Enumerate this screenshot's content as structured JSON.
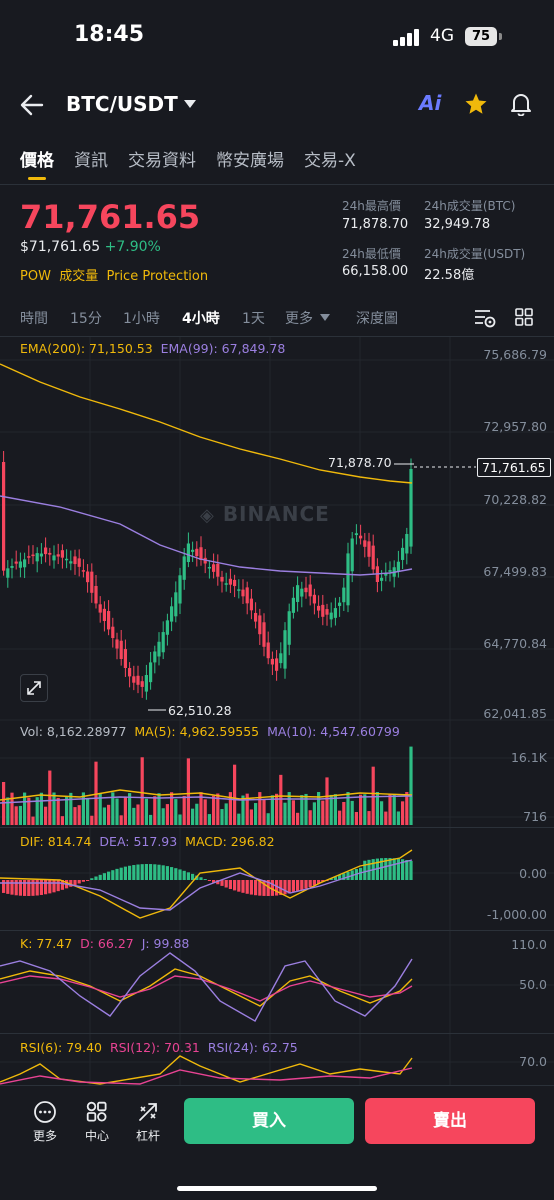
{
  "status_bar": {
    "time": "18:45",
    "network": "4G",
    "battery": "75"
  },
  "header": {
    "pair": "BTC/USDT",
    "icons": [
      "back-arrow-icon",
      "dropdown-caret-icon",
      "ai-icon",
      "star-icon",
      "bell-icon"
    ],
    "ai_label": "Ai"
  },
  "tabs": [
    "價格",
    "資訊",
    "交易資料",
    "幣安廣場",
    "交易-X"
  ],
  "price": {
    "last": "71,761.65",
    "usd": "$71,761.65",
    "change": "+7.90%",
    "tags": [
      "POW",
      "成交量",
      "Price Protection"
    ]
  },
  "stats": {
    "high_label": "24h最高價",
    "high_value": "71,878.70",
    "vol_btc_label": "24h成交量(BTC)",
    "vol_btc_value": "32,949.78",
    "low_label": "24h最低價",
    "low_value": "66,158.00",
    "vol_usdt_label": "24h成交量(USDT)",
    "vol_usdt_value": "22.58億"
  },
  "intervals": {
    "time": "時間",
    "m15": "15分",
    "h1": "1小時",
    "h4": "4小時",
    "d1": "1天",
    "more": "更多",
    "depth": "深度圖"
  },
  "main_chart": {
    "ema200_label": "EMA(200): 71,150.53",
    "ema99_label": "EMA(99): 67,849.78",
    "y_ticks": [
      "75,686.79",
      "72,957.80",
      "70,228.82",
      "67,499.83",
      "64,770.84",
      "62,041.85"
    ],
    "high_marker": "71,878.70",
    "low_marker": "62,510.28",
    "last_price_tag": "71,761.65",
    "watermark": "BINANCE"
  },
  "volume": {
    "vol_label": "Vol: 8,162.28977",
    "ma5_label": "MA(5): 4,962.59555",
    "ma10_label": "MA(10): 4,547.60799",
    "y_ticks": [
      "16.1K",
      "716"
    ]
  },
  "macd": {
    "dif_label": "DIF: 814.74",
    "dea_label": "DEA: 517.93",
    "macd_label": "MACD: 296.82",
    "y_ticks": [
      "0.00",
      "-1,000.00"
    ]
  },
  "kdj": {
    "k_label": "K: 77.47",
    "d_label": "D: 66.27",
    "j_label": "J: 99.88",
    "y_ticks": [
      "110.0",
      "50.0"
    ]
  },
  "rsi": {
    "rsi6_label": "RSI(6): 79.40",
    "rsi12_label": "RSI(12): 70.31",
    "rsi24_label": "RSI(24): 62.75",
    "y_ticks": [
      "70.0"
    ]
  },
  "bottom": {
    "more": "更多",
    "center": "中心",
    "leverage": "杠杆",
    "buy": "買入",
    "sell": "賣出"
  },
  "colors": {
    "up": "#2ebd85",
    "down": "#f6465d",
    "accent": "#f0b90b",
    "ema_purple": "#9b7fe0",
    "background": "#181a20"
  }
}
